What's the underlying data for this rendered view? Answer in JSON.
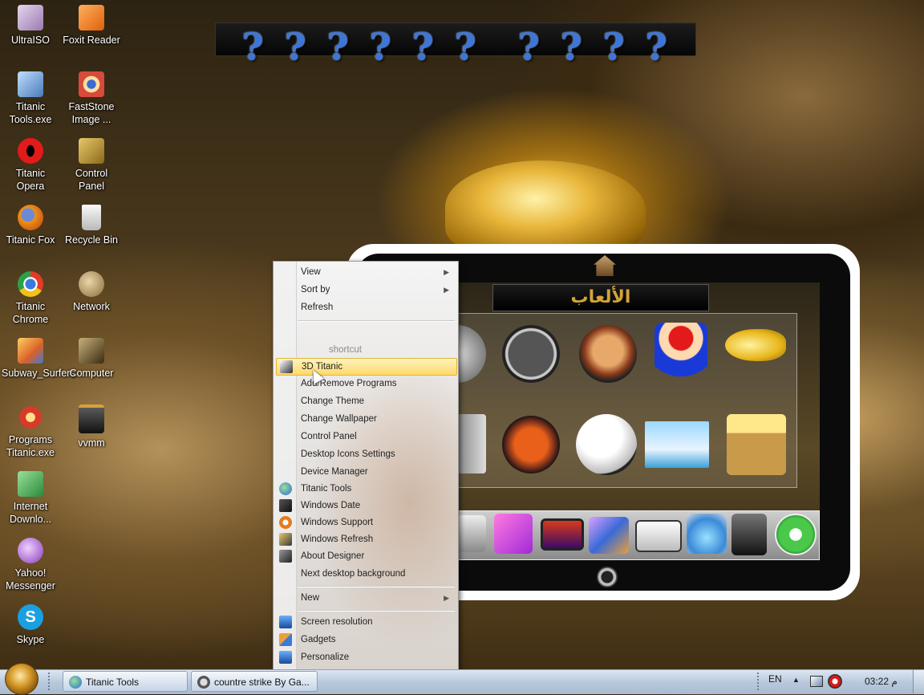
{
  "desktop_icons": [
    {
      "label": "UltraISO",
      "icon": "disc-icon",
      "color": "#c9a7d8"
    },
    {
      "label": "Foxit Reader",
      "icon": "pdf-icon",
      "color": "#f07a1a"
    },
    {
      "label": "Titanic Tools.exe",
      "icon": "tools-icon",
      "color": "#6aa0d8"
    },
    {
      "label": "FastStone Image ...",
      "icon": "eye-icon",
      "color": "#d84a3a"
    },
    {
      "label": "Titanic Opera",
      "icon": "opera-icon",
      "color": "#d61a1a"
    },
    {
      "label": "Control Panel",
      "icon": "control-panel-icon",
      "color": "#c4a03a"
    },
    {
      "label": "Titanic Fox",
      "icon": "firefox-icon",
      "color": "#e88a1a"
    },
    {
      "label": "Recycle Bin",
      "icon": "recycle-bin-icon",
      "color": "#d8d8d8"
    },
    {
      "label": "Titanic Chrome",
      "icon": "chrome-icon",
      "color": "#3a9a3a"
    },
    {
      "label": "Network",
      "icon": "network-icon",
      "color": "#b89a5a"
    },
    {
      "label": "Subway_Surfers",
      "icon": "subway-surfers-icon",
      "color": "#e8a23a"
    },
    {
      "label": "Computer",
      "icon": "computer-icon",
      "color": "#6a5a3a"
    },
    {
      "label": "Programs Titanic.exe",
      "icon": "programs-icon",
      "color": "#c83a2a"
    },
    {
      "label": "vvmm",
      "icon": "folder-icon",
      "color": "#3a3a3a"
    },
    {
      "label": "Internet Downlo...",
      "icon": "download-icon",
      "color": "#3aa04a"
    },
    {
      "label": "Yahoo! Messenger",
      "icon": "yahoo-icon",
      "color": "#8a4ab8"
    },
    {
      "label": "Skype",
      "icon": "skype-icon",
      "color": "#1a9ad8"
    }
  ],
  "question_bar": {
    "mark": "?"
  },
  "tablet": {
    "title": "الألعاب"
  },
  "context_menu": {
    "items": [
      {
        "label": "View",
        "submenu": true
      },
      {
        "label": "Sort by",
        "submenu": true
      },
      {
        "label": "Refresh"
      },
      {
        "label": "shortcut"
      },
      {
        "label": "3D Titanic"
      },
      {
        "label": "Add/Remove Programs"
      },
      {
        "label": "Change Theme"
      },
      {
        "label": "Change Wallpaper"
      },
      {
        "label": "Control Panel"
      },
      {
        "label": "Desktop Icons Settings"
      },
      {
        "label": "Device Manager"
      },
      {
        "label": "Titanic Tools"
      },
      {
        "label": "Windows Date"
      },
      {
        "label": "Windows Support"
      },
      {
        "label": "Windows Refresh"
      },
      {
        "label": "About Designer"
      },
      {
        "label": "Next desktop background"
      },
      {
        "label": "New",
        "submenu": true
      },
      {
        "label": "Screen resolution"
      },
      {
        "label": "Gadgets"
      },
      {
        "label": "Personalize"
      }
    ]
  },
  "taskbar": {
    "buttons": [
      {
        "label": "Titanic Tools"
      },
      {
        "label": "countre strike By Ga..."
      }
    ],
    "language": "EN",
    "tray_up": "▲",
    "time": "03:22 م"
  }
}
